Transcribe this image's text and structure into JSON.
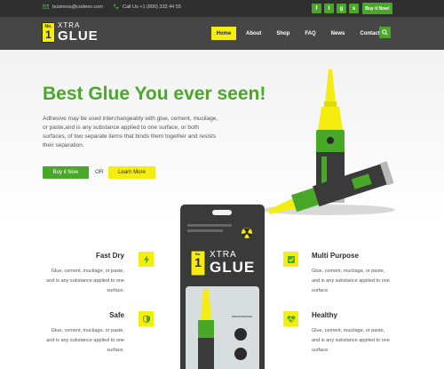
{
  "topbar": {
    "email": "business@codeex.com",
    "phone": "Call Us +1 (800) 333 44 55",
    "buy_now": "Buy it Now!",
    "socials": [
      "facebook-icon",
      "twitter-icon",
      "google-plus-icon",
      "skype-icon"
    ]
  },
  "brand": {
    "no_label": "No.",
    "one_label": "1",
    "xtra": "XTRA",
    "glue": "GLUE"
  },
  "nav": {
    "items": [
      "Home",
      "About",
      "Shop",
      "FAQ",
      "News",
      "Contact"
    ],
    "active": "Home"
  },
  "hero": {
    "title": "Best Glue You ever seen!",
    "description": "Adhesive may be used interchangeably with glue, cement, mucilage, or paste,and is any substance applied to one surface, or both surfaces, of two separate items that binds them together and resists their separation.",
    "buy_label": "Buy it Now",
    "or_label": "OR",
    "learn_label": "Learn More"
  },
  "features": [
    {
      "title": "Fast Dry",
      "line1": "Glue, cement, mucilage, or paste,",
      "line2": "and is any substance applied to one",
      "line3": "surface.",
      "icon": "lightning-icon"
    },
    {
      "title": "Multi Purpose",
      "line1": "Glue, cement, mucilage, or paste,",
      "line2": "and is any substance applied to one",
      "line3": "surface.",
      "icon": "checkbox-icon"
    },
    {
      "title": "Safe",
      "line1": "Glue, cement, mucilage, or paste,",
      "line2": "and is any substance applied to one",
      "line3": "surface.",
      "icon": "shield-icon"
    },
    {
      "title": "Healthy",
      "line1": "Glue, cement, mucilage, or paste,",
      "line2": "and is any substance applied to one",
      "line3": "surface.",
      "icon": "heartbeat-icon"
    }
  ],
  "package": {
    "no_label": "No.",
    "one_label": "1",
    "xtra": "XTRA",
    "glue": "GLUE",
    "pro_label": "PROFESSIONAL"
  },
  "colors": {
    "green": "#4aa829",
    "yellow": "#f4ed0f",
    "dark": "#2f2f2f",
    "nav": "#464646"
  }
}
